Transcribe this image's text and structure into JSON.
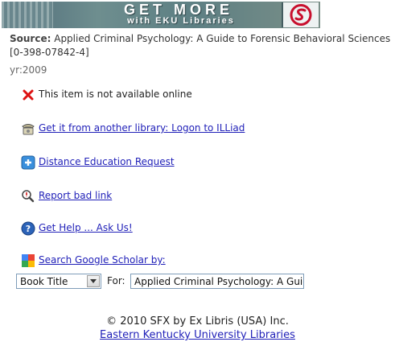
{
  "banner": {
    "line1": "GET MORE",
    "line2": "with EKU Libraries"
  },
  "source": {
    "label": "Source:",
    "value": "Applied Criminal Psychology: A Guide to Forensic Behavioral Sciences [0-398-07842-4]"
  },
  "year": "yr:2009",
  "items": {
    "not_available": "This item is not available online",
    "illiad": "Get it from another library: Logon to ILLiad",
    "distance_ed": "Distance Education Request",
    "report_bad_link": "Report bad link",
    "get_help": "Get Help ... Ask Us!",
    "google_scholar": "Search Google Scholar by:"
  },
  "scholar_search": {
    "select_value": "Book Title",
    "for_label": "For:",
    "input_value": "Applied Criminal Psychology: A Guide to Forensic Behavioral Sciences"
  },
  "footer": {
    "copyright": "© 2010 SFX by Ex Libris (USA) Inc.",
    "library_link": "Eastern Kentucky University Libraries"
  },
  "icons": {
    "not_available": "red-x-icon",
    "illiad": "telephone-icon",
    "distance_ed": "plus-icon",
    "report_bad_link": "magnifier-icon",
    "get_help": "help-question-icon",
    "google_scholar": "google-icon"
  },
  "colors": {
    "link": "#1f1fb8",
    "banner": "#5d7f83"
  }
}
